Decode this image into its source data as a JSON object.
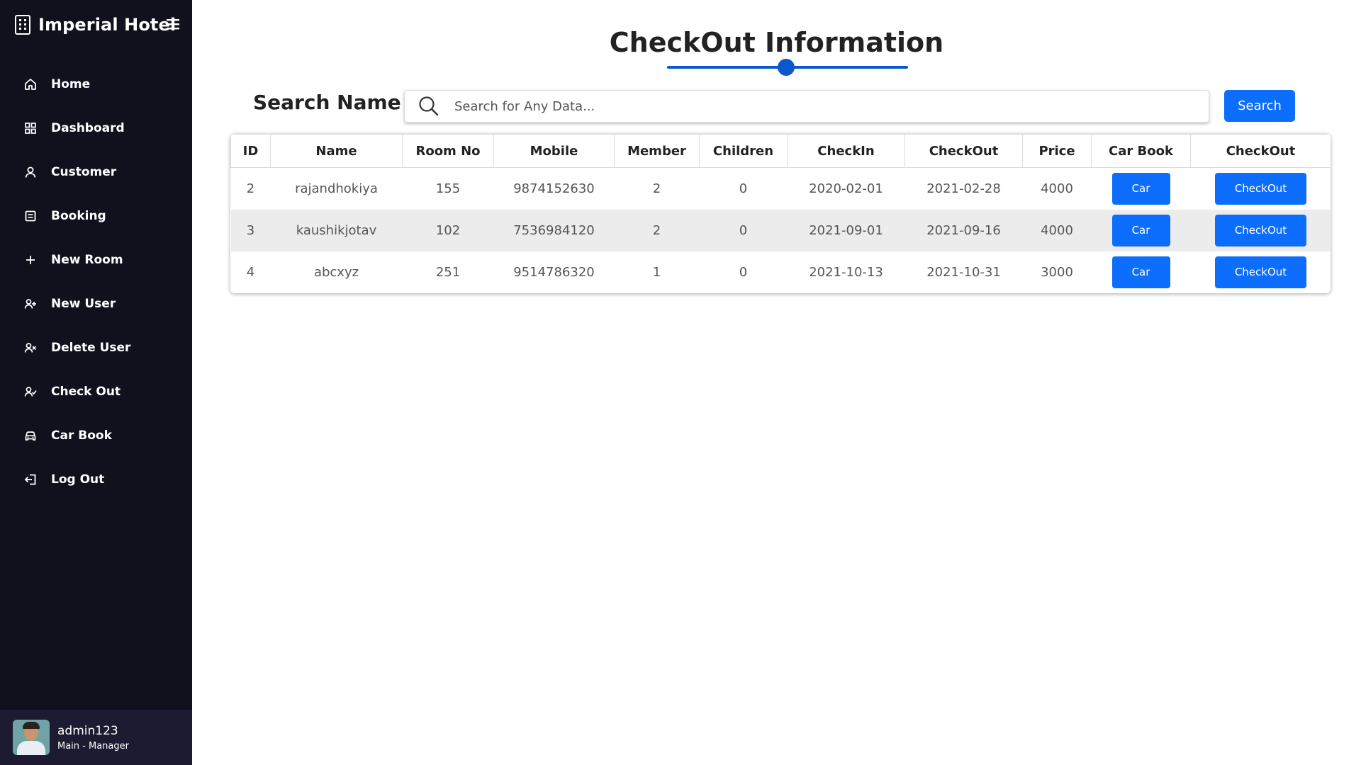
{
  "app": {
    "name": "Imperial Hotel"
  },
  "sidebar": {
    "items": [
      {
        "label": "Home",
        "icon": "home-icon"
      },
      {
        "label": "Dashboard",
        "icon": "grid-icon"
      },
      {
        "label": "Customer",
        "icon": "user-icon"
      },
      {
        "label": "Booking",
        "icon": "booking-icon"
      },
      {
        "label": "New Room",
        "icon": "plus-icon"
      },
      {
        "label": "New User",
        "icon": "user-plus-icon"
      },
      {
        "label": "Delete User",
        "icon": "user-x-icon"
      },
      {
        "label": "Check Out",
        "icon": "user-check-icon"
      },
      {
        "label": "Car Book",
        "icon": "car-icon"
      },
      {
        "label": "Log Out",
        "icon": "logout-icon"
      }
    ]
  },
  "profile": {
    "name": "admin123",
    "role": "Main - Manager"
  },
  "page": {
    "title": "CheckOut Information"
  },
  "search": {
    "label": "Search Name",
    "placeholder": "Search for Any Data...",
    "button": "Search"
  },
  "table": {
    "headers": [
      "ID",
      "Name",
      "Room No",
      "Mobile",
      "Member",
      "Children",
      "CheckIn",
      "CheckOut",
      "Price",
      "Car Book",
      "CheckOut"
    ],
    "rows": [
      {
        "id": "2",
        "name": "rajandhokiya",
        "room": "155",
        "mobile": "9874152630",
        "member": "2",
        "children": "0",
        "checkin": "2020-02-01",
        "checkout": "2021-02-28",
        "price": "4000",
        "car_btn": "Car",
        "checkout_btn": "CheckOut"
      },
      {
        "id": "3",
        "name": "kaushikjotav",
        "room": "102",
        "mobile": "7536984120",
        "member": "2",
        "children": "0",
        "checkin": "2021-09-01",
        "checkout": "2021-09-16",
        "price": "4000",
        "car_btn": "Car",
        "checkout_btn": "CheckOut"
      },
      {
        "id": "4",
        "name": "abcxyz",
        "room": "251",
        "mobile": "9514786320",
        "member": "1",
        "children": "0",
        "checkin": "2021-10-13",
        "checkout": "2021-10-31",
        "price": "3000",
        "car_btn": "Car",
        "checkout_btn": "CheckOut"
      }
    ]
  },
  "colors": {
    "sidebar_bg": "#11101d",
    "profile_bg": "#1d1b31",
    "accent": "#0d6efd",
    "title_accent": "#0a58ca"
  }
}
